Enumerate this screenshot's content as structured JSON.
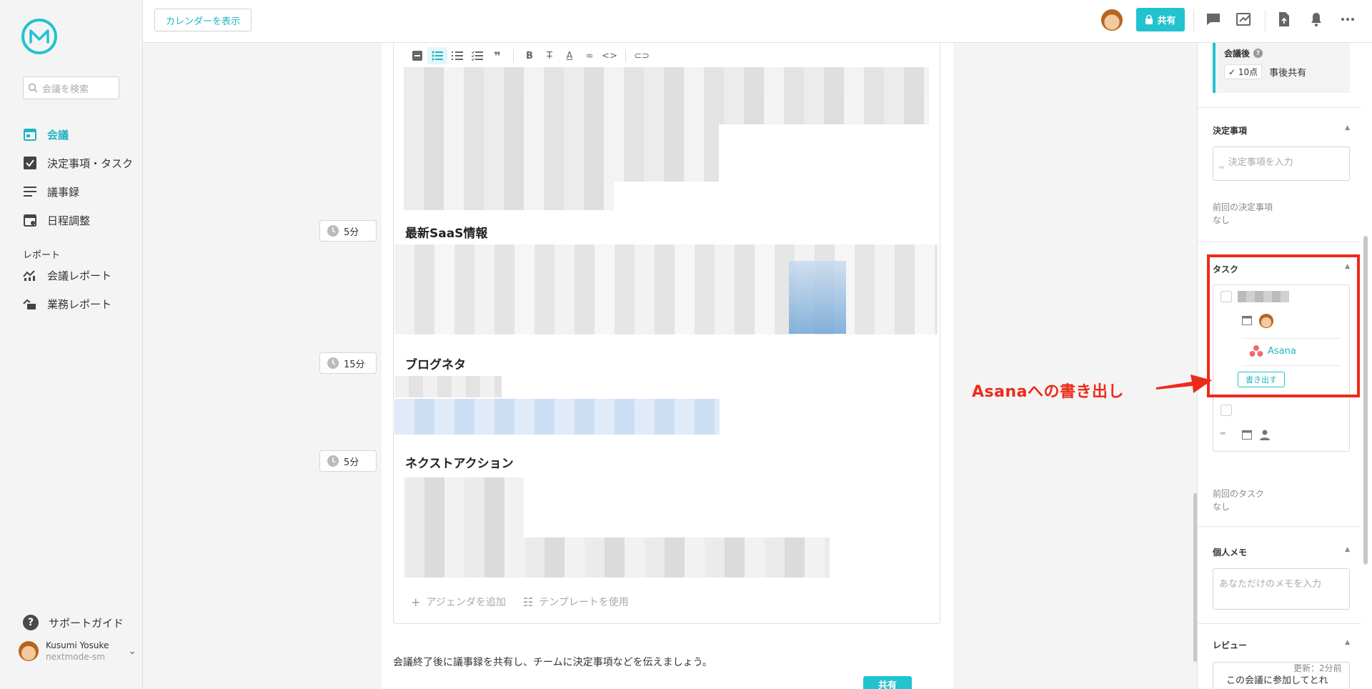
{
  "sidebar": {
    "search_placeholder": "会議を検索",
    "items": [
      {
        "label": "会議"
      },
      {
        "label": "決定事項・タスク"
      },
      {
        "label": "議事録"
      },
      {
        "label": "日程調整"
      }
    ],
    "report_section": "レポート",
    "report_items": [
      {
        "label": "会議レポート"
      },
      {
        "label": "業務レポート"
      }
    ],
    "support": "サポートガイド",
    "user": {
      "name": "Kusumi Yosuke",
      "org": "nextmode-sm"
    }
  },
  "topbar": {
    "calendar_button": "カレンダーを表示",
    "share_button": "共有"
  },
  "agenda": {
    "sections": [
      {
        "title": "最新SaaS情報",
        "duration": "5分"
      },
      {
        "title": "ブログネタ",
        "duration": "15分"
      },
      {
        "title": "ネクストアクション",
        "duration": "5分"
      }
    ],
    "add_agenda": "アジェンダを追加",
    "use_template": "テンプレートを使用",
    "footer_message": "会議終了後に議事録を共有し、チームに決定事項などを伝えましょう。",
    "footer_share": "共有"
  },
  "right_panel": {
    "after_meeting": {
      "title": "会議後",
      "score": "10点",
      "label": "事後共有"
    },
    "decisions": {
      "title": "決定事項",
      "placeholder": "決定事項を入力",
      "prev_label": "前回の決定事項",
      "prev_value": "なし"
    },
    "tasks": {
      "title": "タスク",
      "integration": "Asana",
      "export_button": "書き出す",
      "prev_label": "前回のタスク",
      "prev_value": "なし"
    },
    "memo": {
      "title": "個人メモ",
      "placeholder": "あなただけのメモを入力"
    },
    "review": {
      "title": "レビュー",
      "updated": "更新：2分前",
      "card_text": "この会議に参加してとれ"
    }
  },
  "annotation": {
    "text": "Asanaへの書き出し",
    "color": "#ee2a1a"
  },
  "colors": {
    "accent": "#21c3cf",
    "accent_text": "#1fb5c1"
  }
}
